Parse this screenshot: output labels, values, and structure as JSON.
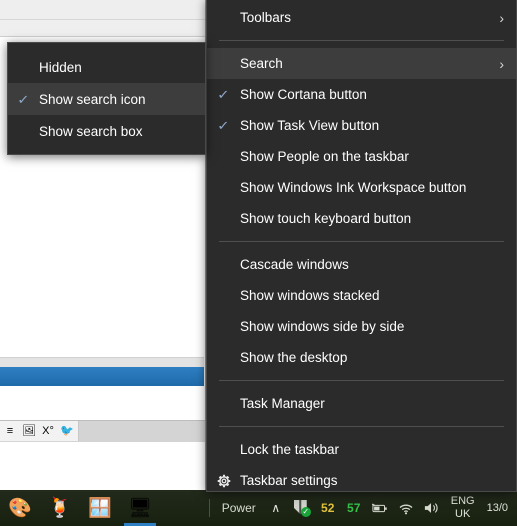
{
  "background_window": {
    "toolbar_icons": [
      {
        "name": "lines-icon",
        "glyph": "≡"
      },
      {
        "name": "picture-icon",
        "glyph": "🖼"
      },
      {
        "name": "superscript-icon",
        "glyph": "X°"
      },
      {
        "name": "twitter-bird-icon",
        "glyph": "🐦"
      }
    ]
  },
  "context_menu": {
    "items": [
      {
        "label": "Toolbars",
        "checked": false,
        "arrow": "›",
        "highlight": false,
        "icon": null
      },
      {
        "separator": true
      },
      {
        "label": "Search",
        "checked": false,
        "arrow": "›",
        "highlight": true,
        "icon": null
      },
      {
        "label": "Show Cortana button",
        "checked": true,
        "arrow": "",
        "highlight": false,
        "icon": null
      },
      {
        "label": "Show Task View button",
        "checked": true,
        "arrow": "",
        "highlight": false,
        "icon": null
      },
      {
        "label": "Show People on the taskbar",
        "checked": false,
        "arrow": "",
        "highlight": false,
        "icon": null
      },
      {
        "label": "Show Windows Ink Workspace button",
        "checked": false,
        "arrow": "",
        "highlight": false,
        "icon": null
      },
      {
        "label": "Show touch keyboard button",
        "checked": false,
        "arrow": "",
        "highlight": false,
        "icon": null
      },
      {
        "separator": true
      },
      {
        "label": "Cascade windows",
        "checked": false,
        "arrow": "",
        "highlight": false,
        "icon": null
      },
      {
        "label": "Show windows stacked",
        "checked": false,
        "arrow": "",
        "highlight": false,
        "icon": null
      },
      {
        "label": "Show windows side by side",
        "checked": false,
        "arrow": "",
        "highlight": false,
        "icon": null
      },
      {
        "label": "Show the desktop",
        "checked": false,
        "arrow": "",
        "highlight": false,
        "icon": null
      },
      {
        "separator": true
      },
      {
        "label": "Task Manager",
        "checked": false,
        "arrow": "",
        "highlight": false,
        "icon": null
      },
      {
        "separator": true
      },
      {
        "label": "Lock the taskbar",
        "checked": false,
        "arrow": "",
        "highlight": false,
        "icon": null
      },
      {
        "label": "Taskbar settings",
        "checked": false,
        "arrow": "",
        "highlight": false,
        "icon": "gear-icon"
      }
    ]
  },
  "search_submenu": {
    "items": [
      {
        "label": "Hidden",
        "checked": false,
        "highlight": false
      },
      {
        "label": "Show search icon",
        "checked": true,
        "highlight": true
      },
      {
        "label": "Show search box",
        "checked": false,
        "highlight": false
      }
    ]
  },
  "taskbar": {
    "apps": [
      {
        "name": "paint-palette-icon",
        "glyph": "🎨",
        "active": false
      },
      {
        "name": "tropical-drink-icon",
        "glyph": "🍹",
        "active": false
      },
      {
        "name": "windows-explorer-icon",
        "glyph": "🪟",
        "active": false
      },
      {
        "name": "task-manager-icon",
        "glyph": "🖥",
        "active": true
      }
    ],
    "tray": {
      "power_label": "Power",
      "overflow_chevron": "∧",
      "security_check": "✓",
      "number_yellow": "52",
      "number_green": "57",
      "battery_icon": "🔋",
      "wifi_icon": "◠",
      "volume_icon": "🔊",
      "lang_top": "ENG",
      "lang_bottom": "UK",
      "clock_top": "13/0",
      "clock_bottom": ""
    }
  },
  "colors": {
    "menu_bg": "#2b2b2b",
    "menu_highlight": "#3d3d3d",
    "menu_border": "#4a4a4a",
    "menu_text": "#ffffff",
    "check_blue": "#8ea8c9",
    "taskbar_bg": "#1b2316",
    "accent_blue": "#2f7fc4",
    "tray_yellow": "#e0c23a",
    "tray_green": "#34c14a"
  }
}
